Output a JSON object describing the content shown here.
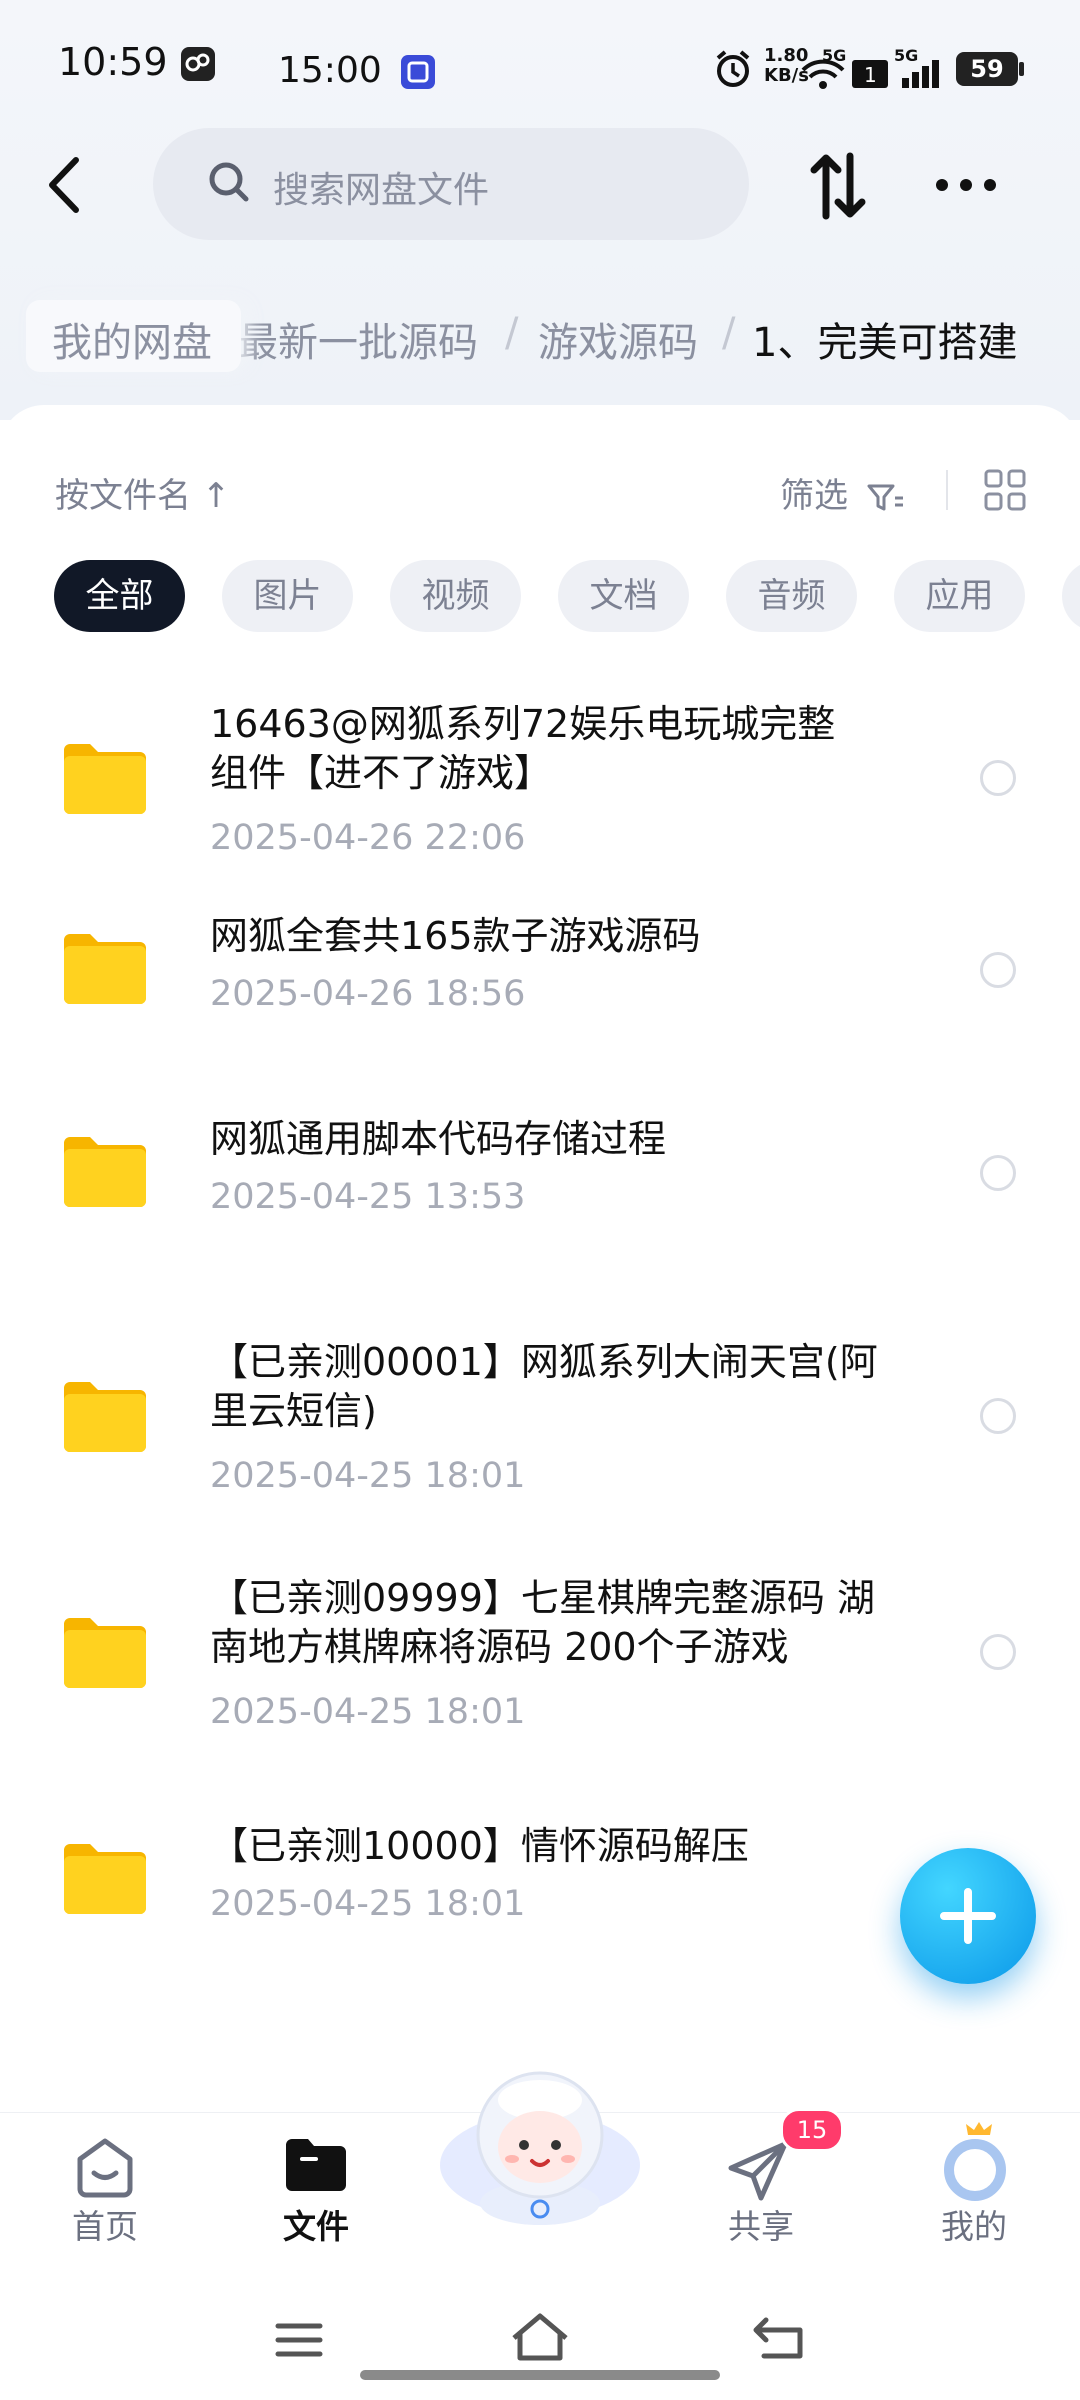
{
  "status_bar": {
    "time": "10:59",
    "second_time": "15:00",
    "net_speed_value": "1.80",
    "net_speed_unit": "KB/s",
    "signal_label_1": "5G",
    "signal_label_2": "5G",
    "battery": "59"
  },
  "header": {
    "search_placeholder": "搜索网盘文件"
  },
  "breadcrumbs": [
    "我的网盘",
    "最新一批源码",
    "游戏源码",
    "1、完美可搭建"
  ],
  "breadcrumb_separator": "/",
  "toolbar": {
    "sort_label": "按文件名",
    "sort_arrow": "↑",
    "filter_label": "筛选"
  },
  "chips": [
    "全部",
    "图片",
    "视频",
    "文档",
    "音频",
    "应用"
  ],
  "files": [
    {
      "name_line1": "16463@网狐系列72娱乐电玩城完整",
      "name_line2": "组件【进不了游戏】",
      "date": "2025-04-26  22:06"
    },
    {
      "name_line1": "网狐全套共165款子游戏源码",
      "name_line2": "",
      "date": "2025-04-26  18:56"
    },
    {
      "name_line1": "网狐通用脚本代码存储过程",
      "name_line2": "",
      "date": "2025-04-25  13:53"
    },
    {
      "name_line1": "【已亲测00001】网狐系列大闹天宫(阿",
      "name_line2": "里云短信)",
      "date": "2025-04-25  18:01"
    },
    {
      "name_line1": "【已亲测09999】七星棋牌完整源码 湖",
      "name_line2": "南地方棋牌麻将源码 200个子游戏",
      "date": "2025-04-25  18:01"
    },
    {
      "name_line1": "【已亲测10000】情怀源码解压",
      "name_line2": "",
      "date": "2025-04-25  18:01"
    }
  ],
  "bottom_nav": {
    "home": "首页",
    "files": "文件",
    "share": "共享",
    "share_badge": "15",
    "mine": "我的"
  },
  "colors": {
    "folder": "#ffc81e",
    "fab": "#1aa9f0",
    "active_chip": "#111827",
    "badge": "#ff3b6b"
  }
}
